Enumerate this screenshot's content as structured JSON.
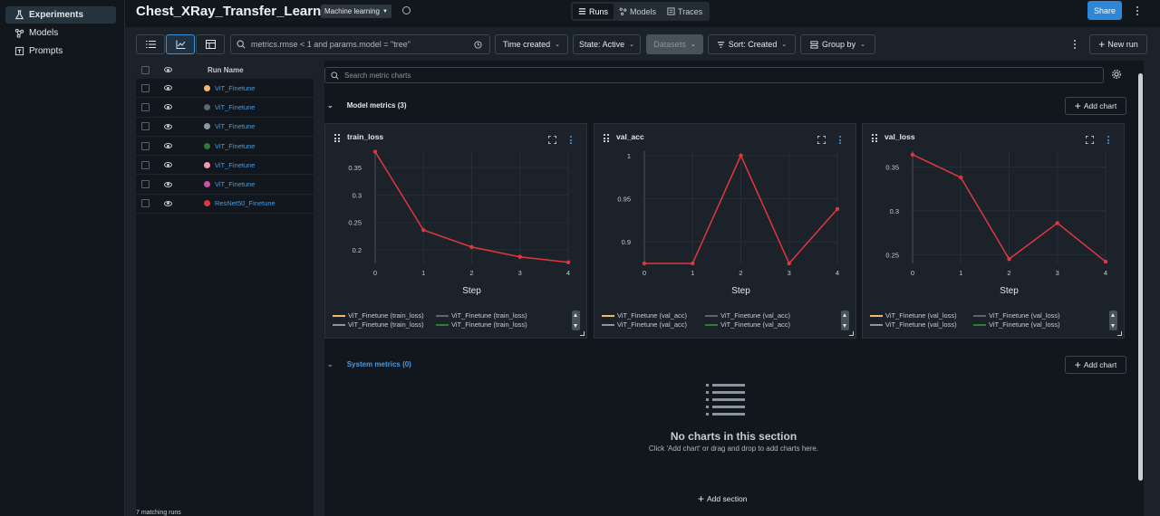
{
  "nav": {
    "items": [
      {
        "label": "Experiments",
        "icon": "beaker-icon",
        "active": true
      },
      {
        "label": "Models",
        "icon": "models-icon",
        "active": false
      },
      {
        "label": "Prompts",
        "icon": "prompts-icon",
        "active": false
      }
    ]
  },
  "header": {
    "title": "Chest_XRay_Transfer_Learning",
    "type_badge": "Machine learning",
    "views": [
      "Runs",
      "Models",
      "Traces"
    ],
    "share_label": "Share"
  },
  "toolbar": {
    "search_query": "metrics.rmse < 1 and params.model = \"tree\"",
    "time_created": "Time created",
    "state": "State: Active",
    "datasets": "Datasets",
    "sort": "Sort: Created",
    "group_by": "Group by",
    "new_run": "New run"
  },
  "runs": {
    "column_header": "Run Name",
    "rows": [
      {
        "name": "ViT_Finetune",
        "color": "#f4b76b"
      },
      {
        "name": "ViT_Finetune",
        "color": "#5c6670"
      },
      {
        "name": "ViT_Finetune",
        "color": "#8c979f"
      },
      {
        "name": "ViT_Finetune",
        "color": "#2e7d32"
      },
      {
        "name": "ViT_Finetune",
        "color": "#f598a8"
      },
      {
        "name": "ViT_Finetune",
        "color": "#d04fa6"
      },
      {
        "name": "ResNet50_Finetune",
        "color": "#e0373f"
      }
    ],
    "footer": "7 matching runs"
  },
  "charts_panel": {
    "search_placeholder": "Search metric charts",
    "model_section": "Model metrics (3)",
    "system_section": "System metrics (0)",
    "add_chart": "Add chart",
    "empty_title": "No charts in this section",
    "empty_sub": "Click 'Add chart' or drag and drop to add charts here.",
    "add_section": "Add section"
  },
  "chart_data": [
    {
      "type": "line",
      "title": "train_loss",
      "xlabel": "Step",
      "x": [
        0,
        1,
        2,
        3,
        4
      ],
      "xticks": [
        "0",
        "1",
        "2",
        "3",
        "4"
      ],
      "yticks": [
        "0.35",
        "0.3",
        "0.25",
        "0.2"
      ],
      "ytick_values": [
        0.35,
        0.3,
        0.25,
        0.2
      ],
      "ylim": [
        0.175,
        0.38
      ],
      "series": [
        {
          "name": "ResNet50_Finetune",
          "color": "#e0373f",
          "values": [
            0.379,
            0.236,
            0.205,
            0.187,
            0.177
          ]
        }
      ],
      "legend": [
        {
          "label": "ViT_Finetune (train_loss)",
          "color": "#f4b76b"
        },
        {
          "label": "ViT_Finetune (train_loss)",
          "color": "#5c6670"
        },
        {
          "label": "ViT_Finetune (train_loss)",
          "color": "#8c979f"
        },
        {
          "label": "ViT_Finetune (train_loss)",
          "color": "#2e7d32"
        }
      ]
    },
    {
      "type": "line",
      "title": "val_acc",
      "xlabel": "Step",
      "x": [
        0,
        1,
        2,
        3,
        4
      ],
      "xticks": [
        "0",
        "1",
        "2",
        "3",
        "4"
      ],
      "yticks": [
        "1",
        "0.95",
        "0.9"
      ],
      "ytick_values": [
        1,
        0.95,
        0.9
      ],
      "ylim": [
        0.875,
        1.005
      ],
      "series": [
        {
          "name": "ResNet50_Finetune",
          "color": "#e0373f",
          "values": [
            0.875,
            0.875,
            1.0,
            0.875,
            0.938
          ]
        }
      ],
      "legend": [
        {
          "label": "ViT_Finetune (val_acc)",
          "color": "#f4b76b"
        },
        {
          "label": "ViT_Finetune (val_acc)",
          "color": "#5c6670"
        },
        {
          "label": "ViT_Finetune (val_acc)",
          "color": "#8c979f"
        },
        {
          "label": "ViT_Finetune (val_acc)",
          "color": "#2e7d32"
        }
      ]
    },
    {
      "type": "line",
      "title": "val_loss",
      "xlabel": "Step",
      "x": [
        0,
        1,
        2,
        3,
        4
      ],
      "xticks": [
        "0",
        "1",
        "2",
        "3",
        "4"
      ],
      "yticks": [
        "0.35",
        "0.3",
        "0.25"
      ],
      "ytick_values": [
        0.35,
        0.3,
        0.25
      ],
      "ylim": [
        0.24,
        0.368
      ],
      "series": [
        {
          "name": "ResNet50_Finetune",
          "color": "#e0373f",
          "values": [
            0.364,
            0.338,
            0.245,
            0.286,
            0.242
          ]
        }
      ],
      "legend": [
        {
          "label": "ViT_Finetune (val_loss)",
          "color": "#f4b76b"
        },
        {
          "label": "ViT_Finetune (val_loss)",
          "color": "#5c6670"
        },
        {
          "label": "ViT_Finetune (val_loss)",
          "color": "#8c979f"
        },
        {
          "label": "ViT_Finetune (val_loss)",
          "color": "#2e7d32"
        }
      ]
    }
  ]
}
